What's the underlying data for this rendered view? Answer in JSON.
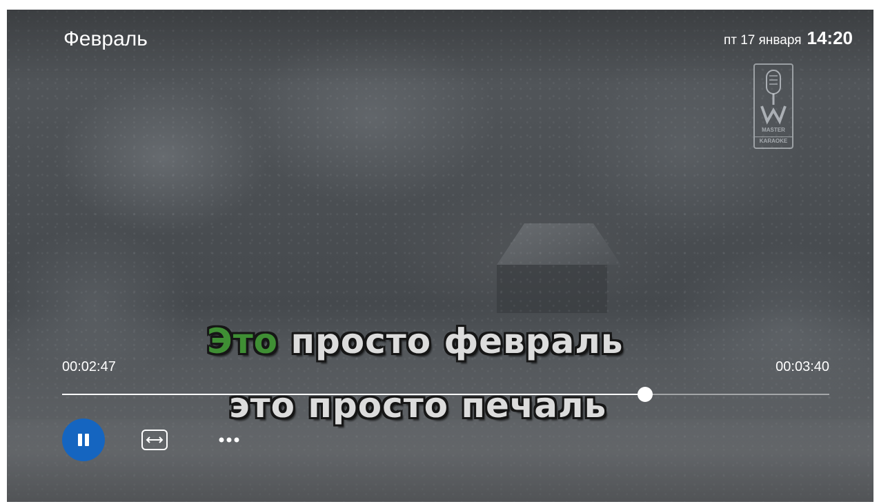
{
  "header": {
    "title": "Февраль",
    "date": "пт 17 января",
    "time": "14:20"
  },
  "watermark": {
    "line1": "MASTER",
    "line2": "KARAOKE"
  },
  "lyrics": {
    "line1_sung": "Это",
    "line1_rest": " просто февраль",
    "line2": "это просто печаль"
  },
  "player": {
    "elapsed": "00:02:47",
    "total": "00:03:40",
    "progress": 0.76
  },
  "controls": {
    "pause_icon": "pause-icon",
    "aspect_icon": "aspect-ratio-icon",
    "more_icon": "more-horizontal-icon"
  },
  "colors": {
    "accent": "#1565c0",
    "sung_lyric": "#3f8f34"
  }
}
